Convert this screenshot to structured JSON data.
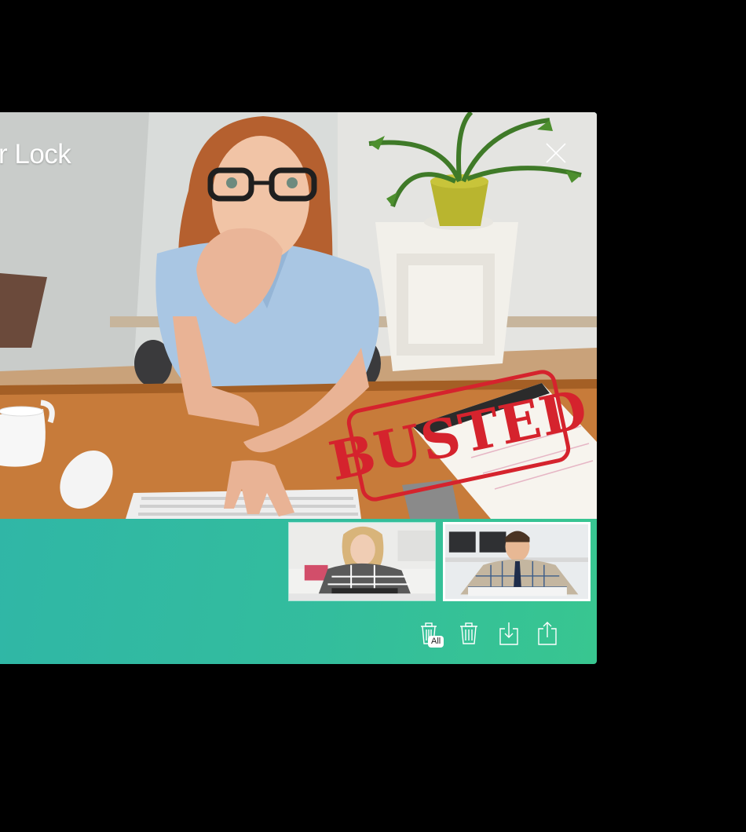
{
  "window": {
    "title": "r Lock",
    "close_icon": "close-icon"
  },
  "photo": {
    "stamp_text": "BUSTED"
  },
  "thumbnails": [
    {
      "name": "thumbnail-1",
      "selected": false
    },
    {
      "name": "thumbnail-2",
      "selected": true
    }
  ],
  "toolbar": {
    "delete_all_badge": "All",
    "icons": [
      "trash-all-icon",
      "trash-icon",
      "download-icon",
      "share-icon"
    ]
  },
  "colors": {
    "panel_start": "#2fb5a8",
    "panel_end": "#38c690",
    "stamp": "#d5232d"
  }
}
